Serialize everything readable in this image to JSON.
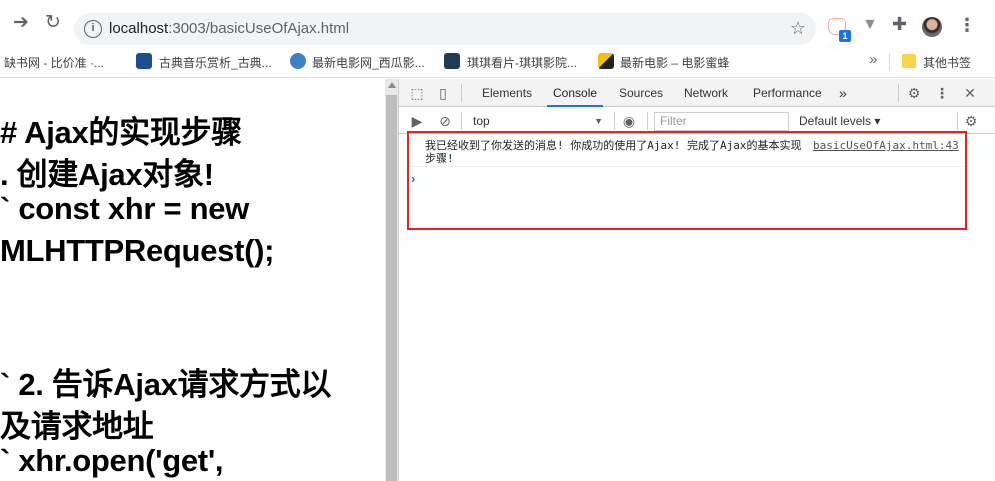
{
  "browser": {
    "url_host": "localhost",
    "url_rest": ":3003/basicUseOfAjax.html",
    "extension_badge": "1",
    "back_icon": "arrow-right",
    "reload_icon": "reload",
    "bookmarks": [
      {
        "label": "缺书网 - 比价准 ·...",
        "icon": "none"
      },
      {
        "label": "古典音乐赏析_古典...",
        "icon": "classical-music-icon"
      },
      {
        "label": "最新电影网_西瓜影...",
        "icon": "movie-site-icon"
      },
      {
        "label": "琪琪看片-琪琪影院...",
        "icon": "film-icon"
      },
      {
        "label": "最新电影 – 电影蜜蜂",
        "icon": "bee-icon"
      }
    ],
    "bookmarks_more": "»",
    "other_bookmarks": "其他书签"
  },
  "page": {
    "lines": [
      "# Ajax的实现步骤",
      ". 创建Ajax对象!",
      "` const xhr = new",
      "MLHTTPRequest();",
      "` 2. 告诉Ajax请求方式以",
      "及请求地址",
      "` xhr.open('get',"
    ]
  },
  "devtools": {
    "tabs": [
      "Elements",
      "Console",
      "Sources",
      "Network",
      "Performance"
    ],
    "active_tab": "Console",
    "more_tabs": "»",
    "context": "top",
    "filter_placeholder": "Filter",
    "levels": "Default levels ▾",
    "log": {
      "message": "我已经收到了你发送的消息! 你成功的使用了Ajax! 完成了Ajax的基本实现步骤!",
      "source": "basicUseOfAjax.html:43"
    },
    "prompt": "›"
  },
  "colors": {
    "accent": "#1a73e8",
    "highlight": "#e02424"
  }
}
